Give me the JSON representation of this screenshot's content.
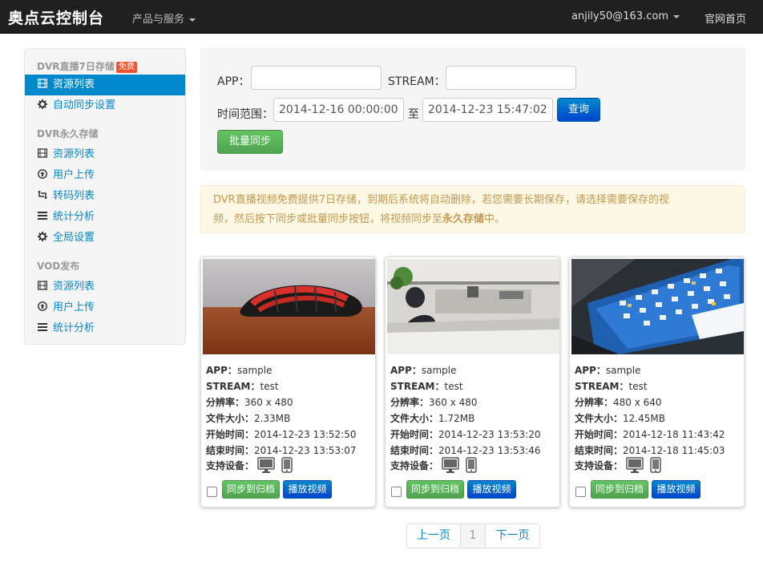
{
  "topbar": {
    "brand": "奥点云控制台",
    "products_menu": "产品与服务",
    "user_email": "anjily50@163.com",
    "home_link": "官网首页"
  },
  "sidebar": {
    "section_dvr7": {
      "title": "DVR直播7日存储",
      "badge": "免费"
    },
    "dvr7_items": [
      {
        "label": "资源列表",
        "icon": "film-icon",
        "active": true
      },
      {
        "label": "自动同步设置",
        "icon": "gear-icon",
        "active": false
      }
    ],
    "section_dvr_perm": {
      "title": "DVR永久存储"
    },
    "dvr_perm_items": [
      {
        "label": "资源列表",
        "icon": "film-icon"
      },
      {
        "label": "用户上传",
        "icon": "upload-icon"
      },
      {
        "label": "转码列表",
        "icon": "retweet-icon"
      },
      {
        "label": "统计分析",
        "icon": "list-icon"
      },
      {
        "label": "全局设置",
        "icon": "gear-icon"
      }
    ],
    "section_vod": {
      "title": "VOD发布"
    },
    "vod_items": [
      {
        "label": "资源列表",
        "icon": "film-icon"
      },
      {
        "label": "用户上传",
        "icon": "upload-icon"
      },
      {
        "label": "统计分析",
        "icon": "list-icon"
      }
    ]
  },
  "search": {
    "app_label": "APP：",
    "app_value": "",
    "stream_label": "STREAM：",
    "stream_value": "",
    "time_range_label": "时间范围：",
    "start_time": "2014-12-16 00:00:00",
    "to_label": "至",
    "end_time": "2014-12-23 15:47:02",
    "query_button": "查询",
    "batch_sync_button": "批量同步"
  },
  "alert": {
    "line1": "DVR直播视频免费提供7日存储，到期后系统将自动删除，若您需要长期保存，请选择需要保存的视",
    "line2_pre": "频，然后按下同步或批量同步按钮，将视频同步至",
    "line2_bold": "永久存储",
    "line2_post": "中。"
  },
  "card_labels": {
    "app": "APP：",
    "stream": "STREAM：",
    "resolution": "分辨率：",
    "file_size": "文件大小：",
    "start_time": "开始时间：",
    "end_time": "结束时间：",
    "devices": "支持设备：",
    "sync_button": "同步到归档",
    "play_button": "播放视频"
  },
  "cards": [
    {
      "app": "sample",
      "stream": "test",
      "resolution": "360 x 480",
      "file_size": "2.33MB",
      "start_time": "2014-12-23 13:52:50",
      "end_time": "2014-12-23 13:53:07",
      "thumbnail": "bike-helmet-photo"
    },
    {
      "app": "sample",
      "stream": "test",
      "resolution": "360 x 480",
      "file_size": "1.72MB",
      "start_time": "2014-12-23 13:53:20",
      "end_time": "2014-12-23 13:53:46",
      "thumbnail": "office-photo"
    },
    {
      "app": "sample",
      "stream": "test",
      "resolution": "480 x 640",
      "file_size": "12.45MB",
      "start_time": "2014-12-18 11:43:42",
      "end_time": "2014-12-18 11:45:03",
      "thumbnail": "monitor-screen-photo"
    }
  ],
  "pagination": {
    "prev": "上一页",
    "current": "1",
    "next": "下一页"
  },
  "colors": {
    "topbar": "#202020",
    "accent_blue": "#0088cc",
    "button_green": "#51a351",
    "alert_bg": "#fcf8e3",
    "alert_text": "#c09853"
  }
}
